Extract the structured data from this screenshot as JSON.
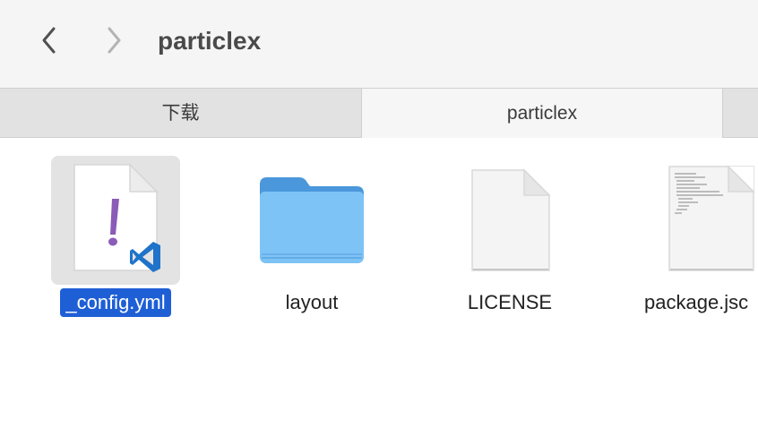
{
  "window": {
    "title": "particlex",
    "back_icon": "chevron-left-icon",
    "forward_icon": "chevron-right-icon"
  },
  "tabs": [
    {
      "label": "下载",
      "active": false
    },
    {
      "label": "particlex",
      "active": true
    },
    {
      "label": "",
      "active": false
    }
  ],
  "files": [
    {
      "name": "_config.yml",
      "icon": "yaml-vscode-file-icon",
      "selected": true
    },
    {
      "name": "layout",
      "icon": "folder-icon",
      "selected": false
    },
    {
      "name": "LICENSE",
      "icon": "blank-document-icon",
      "selected": false
    },
    {
      "name": "package.jsc",
      "icon": "text-document-icon",
      "selected": false
    }
  ],
  "colors": {
    "selection": "#1f5fd6",
    "folder": "#6fb6ee",
    "yaml_mark": "#8b5cb7",
    "vscode_blue": "#1f73c9"
  }
}
